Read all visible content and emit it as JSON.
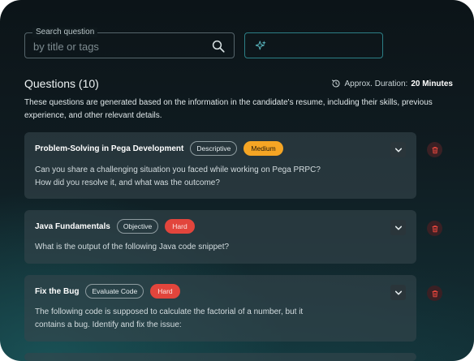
{
  "search": {
    "label": "Search question",
    "placeholder": "by title or tags"
  },
  "questions": {
    "title": "Questions (10)",
    "duration_label": "Approx. Duration:",
    "duration_value": "20 Minutes",
    "description": "These questions are generated based on the information in the candidate's resume, including their skills, previous experience, and other relevant details.",
    "items": [
      {
        "title": "Problem-Solving in Pega Development",
        "type": "Descriptive",
        "difficulty": "Medium",
        "text_lines": [
          "Can you share a challenging situation you faced while working on Pega PRPC?",
          "How did you resolve it, and what was the outcome?"
        ]
      },
      {
        "title": "Java Fundamentals",
        "type": "Objective",
        "difficulty": "Hard",
        "text_lines": [
          "What is the output of the following Java code snippet?"
        ]
      },
      {
        "title": "Fix the Bug",
        "type": "Evaluate Code",
        "difficulty": "Hard",
        "text_lines": [
          "The following code is supposed to calculate the factorial of a number, but it",
          "contains a bug. Identify and fix the issue:"
        ]
      }
    ]
  },
  "colors": {
    "medium": "#f5a524",
    "hard": "#e2453c",
    "accent": "#2c7f86"
  },
  "icons": {
    "search": "search-icon",
    "ai": "sparkle-icon",
    "clock": "clock-icon",
    "expand": "chevron-down-icon",
    "delete": "trash-icon"
  }
}
